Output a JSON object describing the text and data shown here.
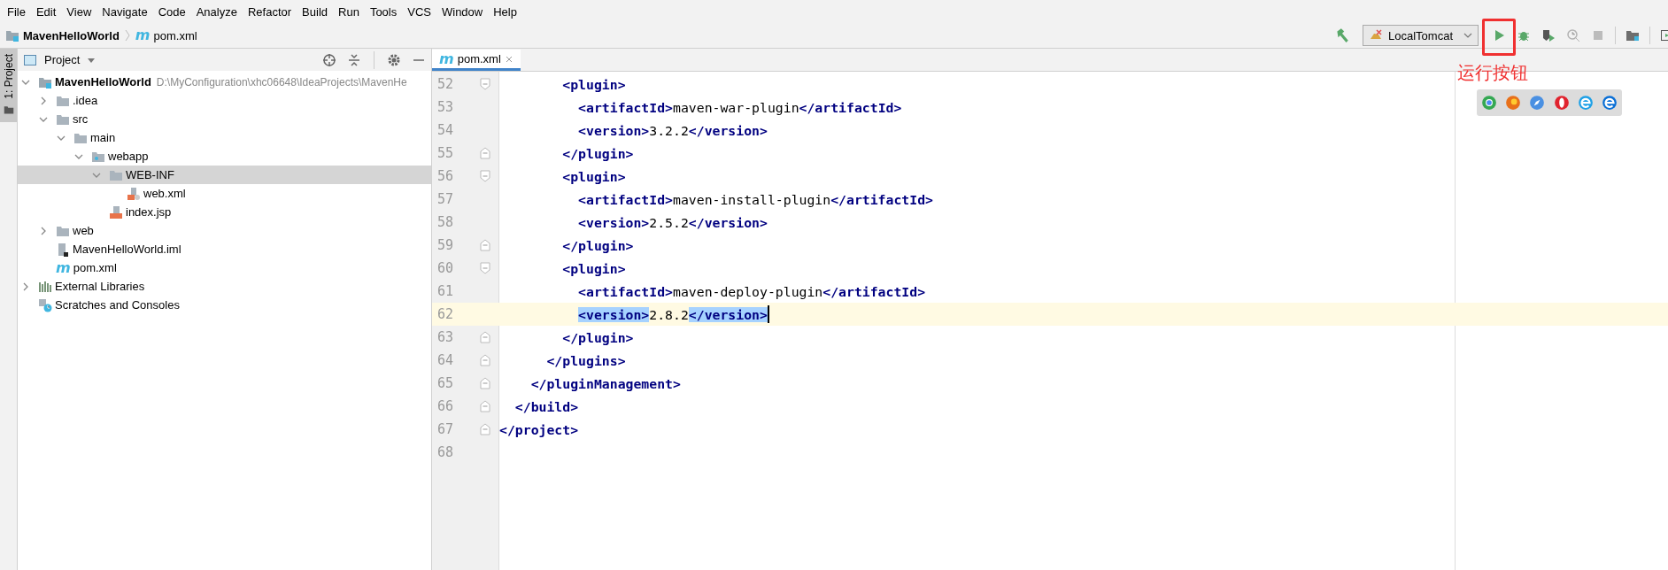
{
  "menu": [
    "File",
    "Edit",
    "View",
    "Navigate",
    "Code",
    "Analyze",
    "Refactor",
    "Build",
    "Run",
    "Tools",
    "VCS",
    "Window",
    "Help"
  ],
  "breadcrumb": [
    {
      "kind": "module",
      "label": "MavenHelloWorld"
    },
    {
      "kind": "maven",
      "icon": "m",
      "label": "pom.xml"
    }
  ],
  "toolbar": {
    "run_config": "LocalTomcat",
    "buttons": [
      {
        "kind": "run",
        "disabled": false
      },
      {
        "kind": "debug",
        "disabled": false
      },
      {
        "kind": "coverage",
        "disabled": false
      },
      {
        "kind": "profile",
        "disabled": true
      },
      {
        "kind": "stop",
        "disabled": true
      },
      {
        "kind": "structure",
        "disabled": false
      },
      {
        "kind": "layout",
        "disabled": false
      }
    ]
  },
  "tool_stripe": {
    "label": "1: Project",
    "selected": true
  },
  "project_panel": {
    "title": "Project",
    "tree": [
      {
        "kind": "module",
        "label": "MavenHelloWorld",
        "path": "D:\\MyConfiguration\\xhc06648\\IdeaProjects\\MavenHe",
        "expanded": true,
        "selected": false,
        "children": [
          {
            "kind": "folder",
            "label": ".idea",
            "expanded": false,
            "selected": false
          },
          {
            "kind": "folder",
            "label": "src",
            "expanded": true,
            "selected": false,
            "children": [
              {
                "kind": "folder",
                "label": "main",
                "expanded": true,
                "selected": false,
                "children": [
                  {
                    "kind": "webfolder",
                    "label": "webapp",
                    "expanded": true,
                    "selected": false,
                    "children": [
                      {
                        "kind": "folder",
                        "label": "WEB-INF",
                        "expanded": true,
                        "selected": true,
                        "children": [
                          {
                            "kind": "xml",
                            "label": "web.xml",
                            "selected": false
                          }
                        ]
                      },
                      {
                        "kind": "jsp",
                        "label": "index.jsp",
                        "selected": false
                      }
                    ]
                  }
                ]
              }
            ]
          },
          {
            "kind": "folder",
            "label": "web",
            "expanded": false,
            "selected": false
          },
          {
            "kind": "iml",
            "label": "MavenHelloWorld.iml",
            "selected": false
          },
          {
            "kind": "maven",
            "icon": "m",
            "label": "pom.xml",
            "selected": false
          }
        ]
      },
      {
        "kind": "libraries",
        "label": "External Libraries",
        "expanded": false,
        "selected": false
      },
      {
        "kind": "scratches",
        "label": "Scratches and Consoles",
        "selected": false
      }
    ]
  },
  "editor": {
    "tabs": [
      {
        "icon": "m",
        "label": "pom.xml",
        "selected": true
      }
    ],
    "lines": [
      {
        "number": "52",
        "fold_start": true,
        "fold_end": false,
        "current": false,
        "tokens": [
          {
            "kind": "tag",
            "text": "        <plugin>"
          }
        ]
      },
      {
        "number": "53",
        "fold_start": false,
        "fold_end": false,
        "current": false,
        "tokens": [
          {
            "kind": "tag",
            "text": "          <artifactId>"
          },
          {
            "kind": "text",
            "text": "maven-war-plugin"
          },
          {
            "kind": "tag",
            "text": "</artifactId>"
          }
        ]
      },
      {
        "number": "54",
        "fold_start": false,
        "fold_end": false,
        "current": false,
        "tokens": [
          {
            "kind": "tag",
            "text": "          <version>"
          },
          {
            "kind": "text",
            "text": "3.2.2"
          },
          {
            "kind": "tag",
            "text": "</version>"
          }
        ]
      },
      {
        "number": "55",
        "fold_start": false,
        "fold_end": true,
        "current": false,
        "tokens": [
          {
            "kind": "tag",
            "text": "        </plugin>"
          }
        ]
      },
      {
        "number": "56",
        "fold_start": true,
        "fold_end": false,
        "current": false,
        "tokens": [
          {
            "kind": "tag",
            "text": "        <plugin>"
          }
        ]
      },
      {
        "number": "57",
        "fold_start": false,
        "fold_end": false,
        "current": false,
        "tokens": [
          {
            "kind": "tag",
            "text": "          <artifactId>"
          },
          {
            "kind": "text",
            "text": "maven-install-plugin"
          },
          {
            "kind": "tag",
            "text": "</artifactId>"
          }
        ]
      },
      {
        "number": "58",
        "fold_start": false,
        "fold_end": false,
        "current": false,
        "tokens": [
          {
            "kind": "tag",
            "text": "          <version>"
          },
          {
            "kind": "text",
            "text": "2.5.2"
          },
          {
            "kind": "tag",
            "text": "</version>"
          }
        ]
      },
      {
        "number": "59",
        "fold_start": false,
        "fold_end": true,
        "current": false,
        "tokens": [
          {
            "kind": "tag",
            "text": "        </plugin>"
          }
        ]
      },
      {
        "number": "60",
        "fold_start": true,
        "fold_end": false,
        "current": false,
        "tokens": [
          {
            "kind": "tag",
            "text": "        <plugin>"
          }
        ]
      },
      {
        "number": "61",
        "fold_start": false,
        "fold_end": false,
        "current": false,
        "tokens": [
          {
            "kind": "tag",
            "text": "          <artifactId>"
          },
          {
            "kind": "text",
            "text": "maven-deploy-plugin"
          },
          {
            "kind": "tag",
            "text": "</artifactId>"
          }
        ]
      },
      {
        "number": "62",
        "fold_start": false,
        "fold_end": false,
        "current": true,
        "tokens": [
          {
            "kind": "tag",
            "text": "          <version>",
            "selected": true
          },
          {
            "kind": "text",
            "text": "2.8.2"
          },
          {
            "kind": "tag",
            "text": "</version>",
            "selected": true
          }
        ]
      },
      {
        "number": "63",
        "fold_start": false,
        "fold_end": true,
        "current": false,
        "tokens": [
          {
            "kind": "tag",
            "text": "        </plugin>"
          }
        ]
      },
      {
        "number": "64",
        "fold_start": false,
        "fold_end": true,
        "current": false,
        "tokens": [
          {
            "kind": "tag",
            "text": "      </plugins>"
          }
        ]
      },
      {
        "number": "65",
        "fold_start": false,
        "fold_end": true,
        "current": false,
        "tokens": [
          {
            "kind": "tag",
            "text": "    </pluginManagement>"
          }
        ]
      },
      {
        "number": "66",
        "fold_start": false,
        "fold_end": true,
        "current": false,
        "tokens": [
          {
            "kind": "tag",
            "text": "  </build>"
          }
        ]
      },
      {
        "number": "67",
        "fold_start": false,
        "fold_end": true,
        "current": false,
        "tokens": [
          {
            "kind": "tag",
            "text": "</project>"
          }
        ]
      },
      {
        "number": "68",
        "fold_start": false,
        "fold_end": false,
        "current": false
      }
    ]
  },
  "annotation": {
    "label": "运行按钮"
  },
  "browser_icons": [
    {
      "kind": "chrome"
    },
    {
      "kind": "firefox"
    },
    {
      "kind": "safari"
    },
    {
      "kind": "opera"
    },
    {
      "kind": "ie"
    },
    {
      "kind": "edge"
    }
  ]
}
